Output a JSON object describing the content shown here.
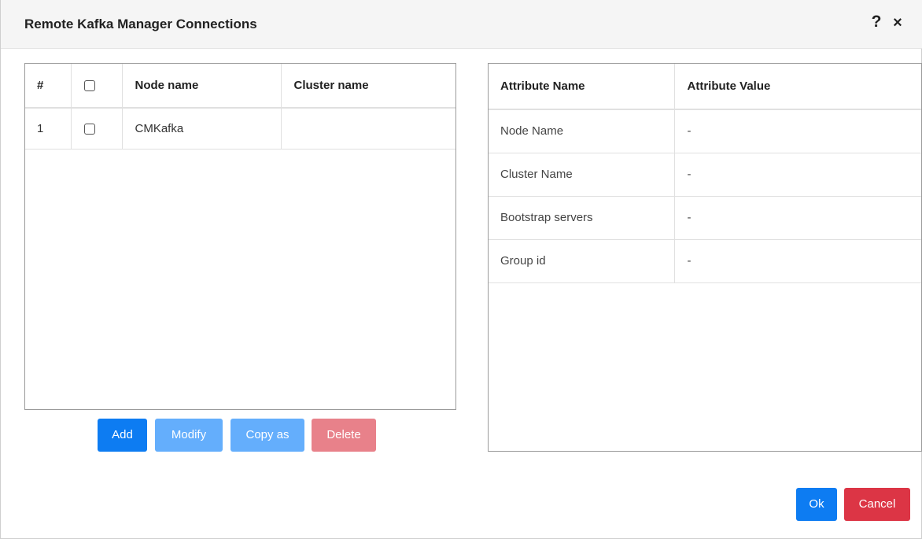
{
  "dialog": {
    "title": "Remote Kafka Manager Connections",
    "help_icon": "?",
    "close_icon": "×"
  },
  "connections_table": {
    "headers": {
      "num": "#",
      "node_name": "Node name",
      "cluster_name": "Cluster name"
    },
    "rows": [
      {
        "num": "1",
        "node_name": "CMKafka",
        "cluster_name": "",
        "checked": false
      }
    ]
  },
  "attributes_table": {
    "headers": {
      "name": "Attribute Name",
      "value": "Attribute Value"
    },
    "rows": [
      {
        "name": "Node Name",
        "value": "-"
      },
      {
        "name": "Cluster Name",
        "value": "-"
      },
      {
        "name": "Bootstrap servers",
        "value": "-"
      },
      {
        "name": "Group id",
        "value": "-"
      }
    ]
  },
  "buttons": {
    "add": "Add",
    "modify": "Modify",
    "copy_as": "Copy as",
    "delete": "Delete",
    "ok": "Ok",
    "cancel": "Cancel"
  },
  "colors": {
    "primary": "#0d7cf2",
    "primary_disabled": "#64aefc",
    "danger": "#dc3545",
    "danger_disabled": "#e8818a"
  }
}
